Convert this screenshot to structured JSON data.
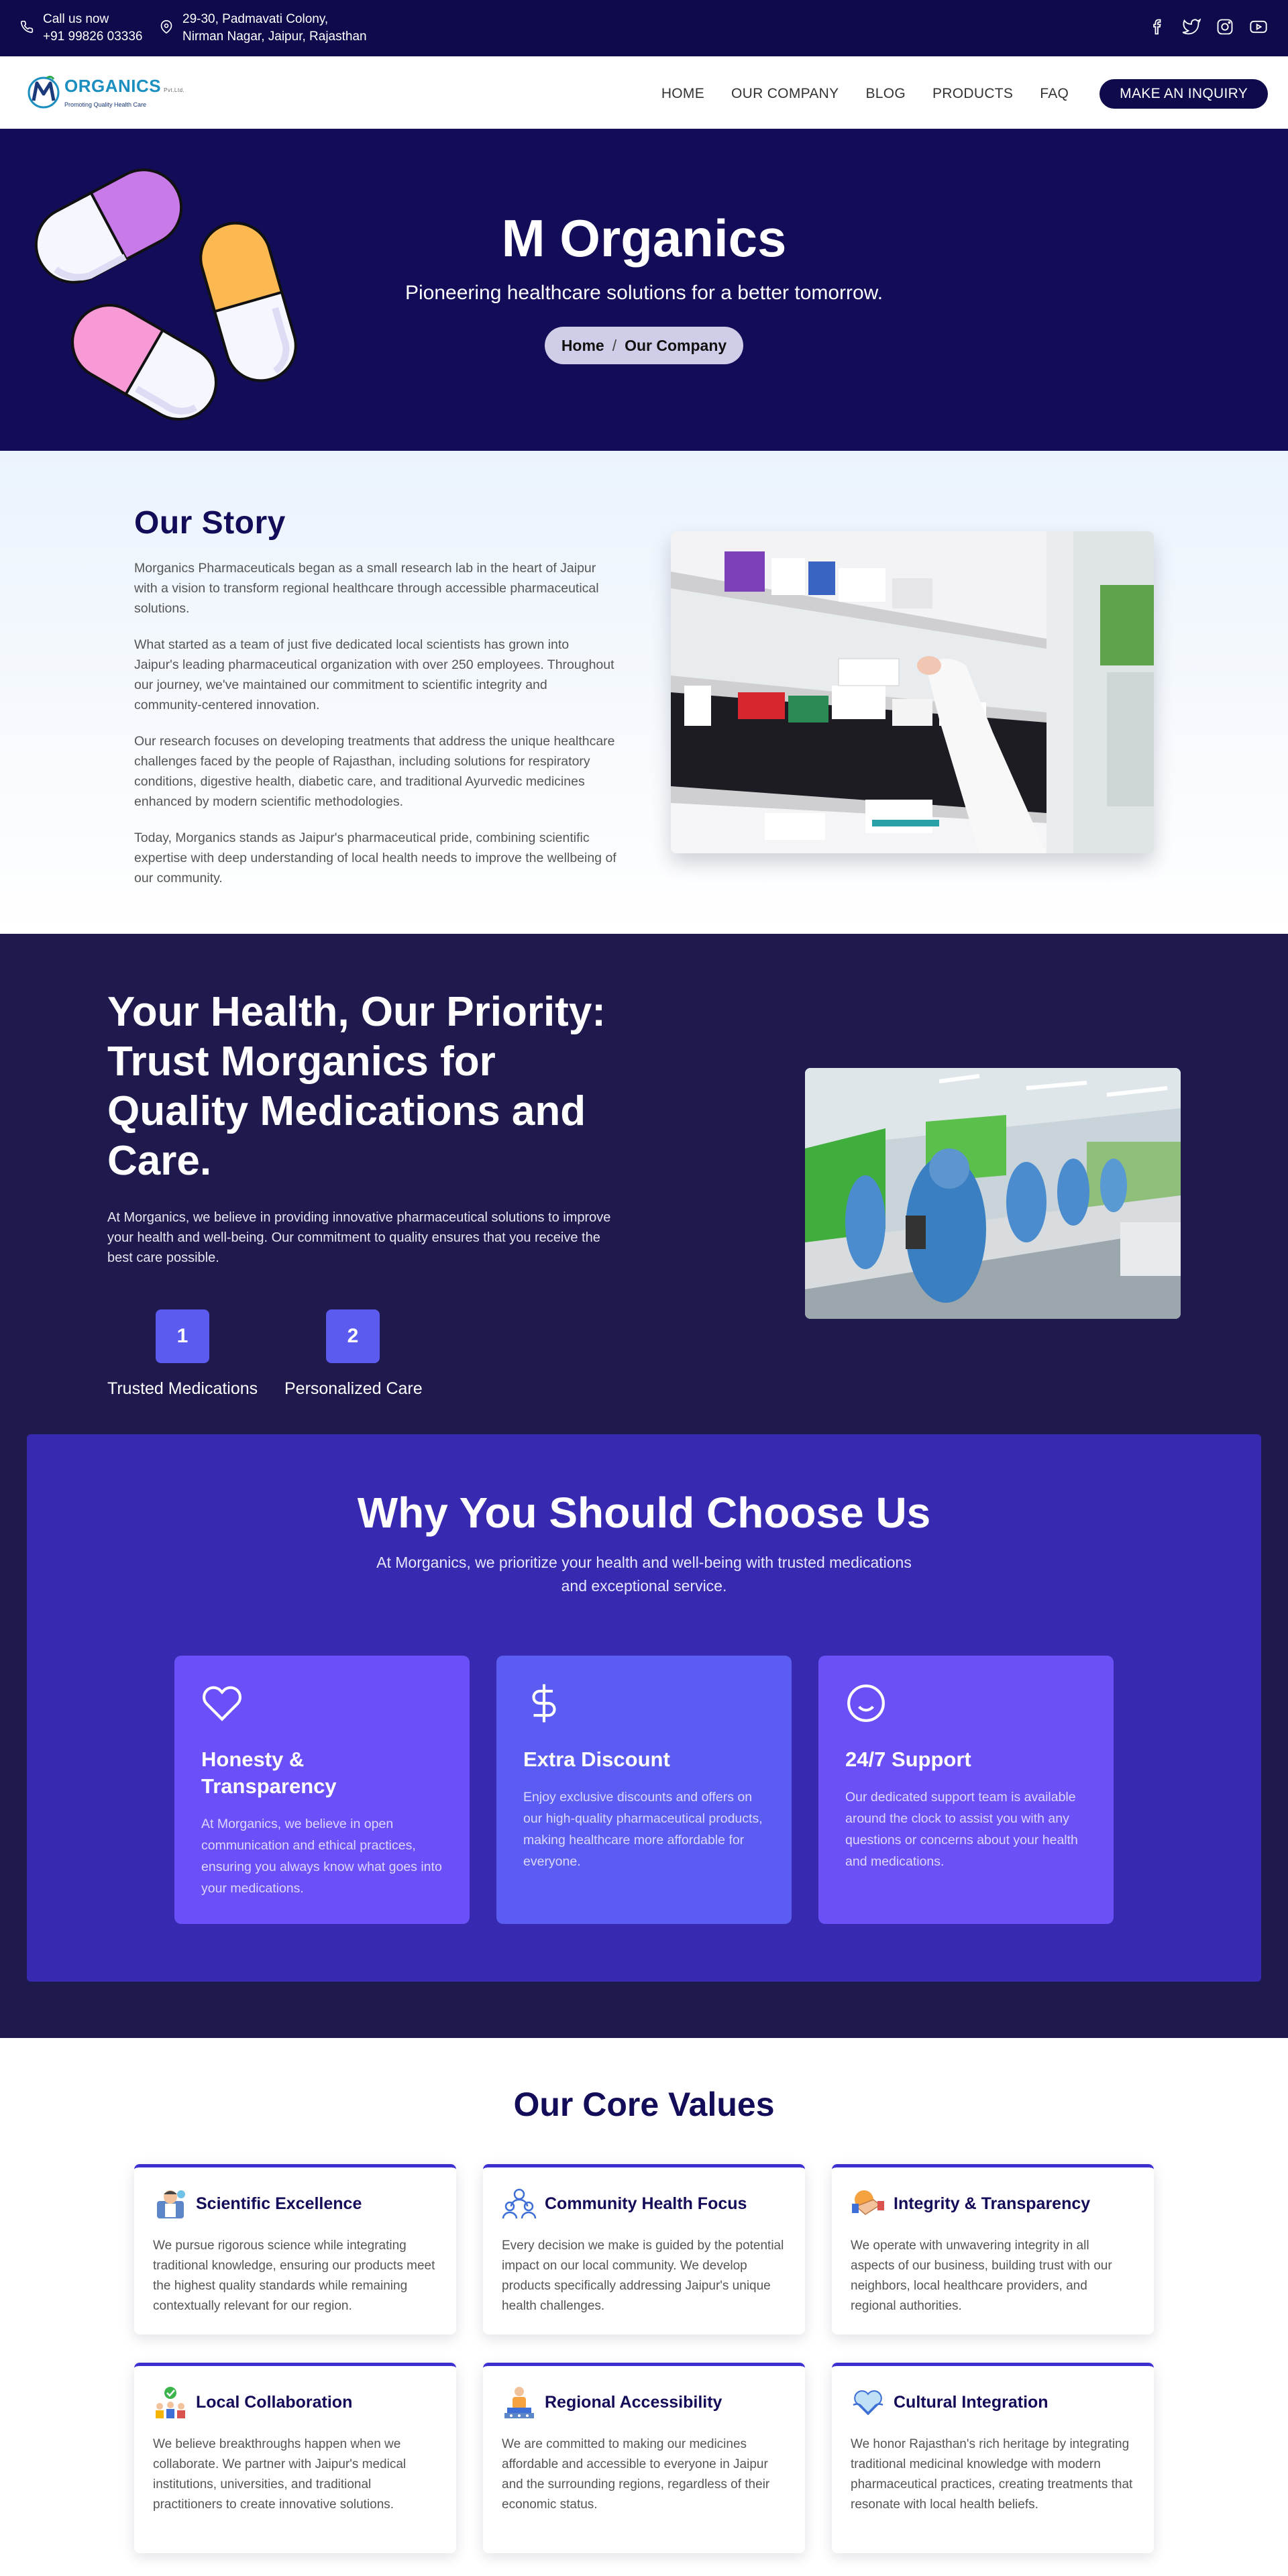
{
  "topbar": {
    "call_label": "Call us now",
    "phone": "+91 99826 03336",
    "address_line1": "29-30, Padmavati Colony,",
    "address_line2": "Nirman Nagar, Jaipur, Rajasthan",
    "social_icons": [
      "facebook-icon",
      "twitter-icon",
      "instagram-icon",
      "youtube-icon"
    ],
    "background": "#0e0a4c"
  },
  "nav": {
    "logo_name": "ORGANICS",
    "logo_suffix": "Pvt.Ltd.",
    "logo_tagline": "Promoting Quality Health Care",
    "items": [
      "HOME",
      "OUR COMPANY",
      "BLOG",
      "PRODUCTS",
      "FAQ"
    ],
    "cta": "MAKE AN INQUIRY"
  },
  "hero": {
    "title": "M Organics",
    "subtitle": "Pioneering healthcare solutions for a better tomorrow.",
    "breadcrumb": [
      "Home",
      "/",
      "Our Company"
    ],
    "background": "#130c58"
  },
  "story": {
    "title": "Our Story",
    "paragraphs": [
      "Morganics Pharmaceuticals began as a small research lab in the heart of Jaipur with a vision to transform regional healthcare through accessible pharmaceutical solutions.",
      "What started as a team of just five dedicated local scientists has grown into Jaipur's leading pharmaceutical organization with over 250 employees. Throughout our journey, we've maintained our commitment to scientific integrity and community-centered innovation.",
      "Our research focuses on developing treatments that address the unique healthcare challenges faced by the people of Rajasthan, including solutions for respiratory conditions, digestive health, diabetic care, and traditional Ayurvedic medicines enhanced by modern scientific methodologies.",
      "Today, Morganics stands as Jaipur's pharmaceutical pride, combining scientific expertise with deep understanding of local health needs to improve the wellbeing of our community."
    ]
  },
  "priority": {
    "title": "Your Health, Our Priority: Trust Morganics for Quality Medications and Care.",
    "text": "At Morganics, we believe in providing innovative pharmaceutical solutions to improve your health and well-being. Our commitment to quality ensures that you receive the best care possible.",
    "stats": [
      {
        "number": "1",
        "label": "Trusted Medications"
      },
      {
        "number": "2",
        "label": "Personalized Care"
      }
    ]
  },
  "choose": {
    "title": "Why You Should Choose Us",
    "subtitle": "At Morganics, we prioritize your health and well-being with trusted medications and exceptional service.",
    "cards": [
      {
        "icon": "heart-icon",
        "title": "Honesty & Transparency",
        "text": "At Morganics, we believe in open communication and ethical practices, ensuring you always know what goes into your medications."
      },
      {
        "icon": "dollar-icon",
        "title": "Extra Discount",
        "text": "Enjoy exclusive discounts and offers on our high-quality pharmaceutical products, making healthcare more affordable for everyone."
      },
      {
        "icon": "smile-icon",
        "title": "24/7 Support",
        "text": "Our dedicated support team is available around the clock to assist you with any questions or concerns about your health and medications."
      }
    ]
  },
  "values": {
    "title": "Our Core Values",
    "items": [
      {
        "icon": "scientist-icon",
        "title": "Scientific Excellence",
        "text": "We pursue rigorous science while integrating traditional knowledge, ensuring our products meet the highest quality standards while remaining contextually relevant for our region."
      },
      {
        "icon": "community-icon",
        "title": "Community Health Focus",
        "text": "Every decision we make is guided by the potential impact on our local community. We develop products specifically addressing Jaipur's unique health challenges."
      },
      {
        "icon": "handshake-icon",
        "title": "Integrity & Transparency",
        "text": "We operate with unwavering integrity in all aspects of our business, building trust with our neighbors, local healthcare providers, and regional authorities."
      },
      {
        "icon": "collaboration-icon",
        "title": "Local Collaboration",
        "text": "We believe breakthroughs happen when we collaborate. We partner with Jaipur's medical institutions, universities, and traditional practitioners to create innovative solutions."
      },
      {
        "icon": "accessibility-icon",
        "title": "Regional Accessibility",
        "text": "We are committed to making our medicines affordable and accessible to everyone in Jaipur and the surrounding regions, regardless of their economic status."
      },
      {
        "icon": "heart-hands-icon",
        "title": "Cultural Integration",
        "text": "We honor Rajasthan's rich heritage by integrating traditional medicinal knowledge with modern pharmaceutical practices, creating treatments that resonate with local health beliefs."
      }
    ]
  }
}
